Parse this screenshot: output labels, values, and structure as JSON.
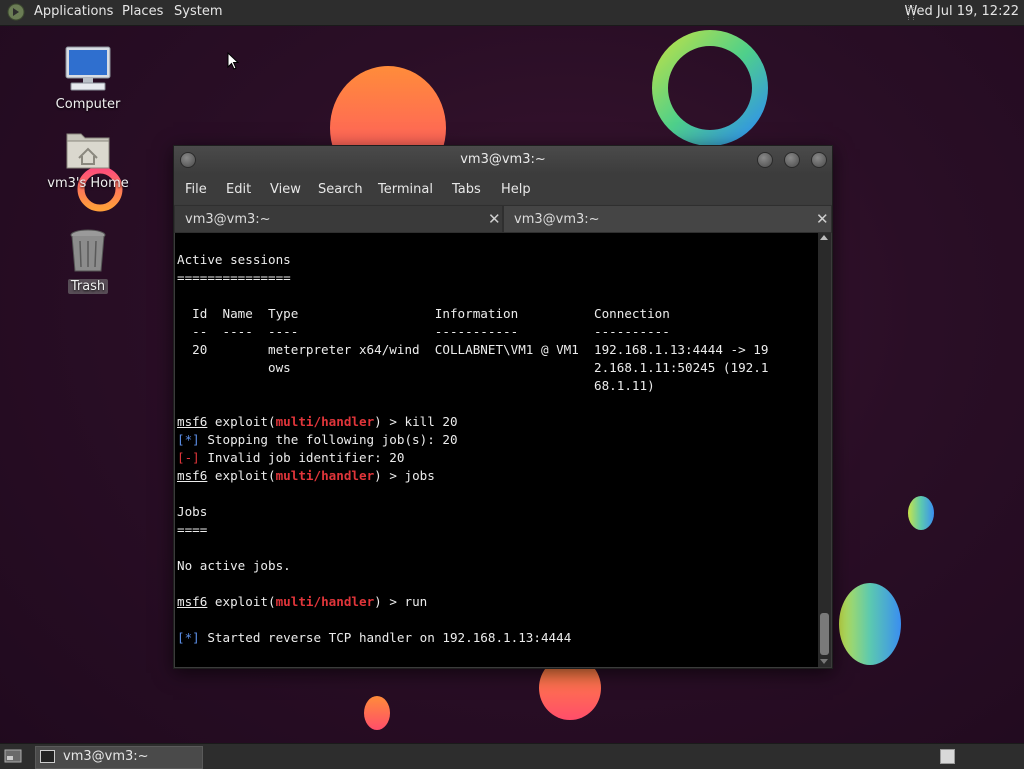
{
  "top_panel": {
    "menu": [
      "Applications",
      "Places",
      "System"
    ],
    "clock": "Wed Jul 19, 12:22"
  },
  "desktop": {
    "icons": [
      {
        "label": "Computer",
        "icon": "computer-icon"
      },
      {
        "label": "vm3's Home",
        "icon": "home-folder-icon"
      },
      {
        "label": "Trash",
        "icon": "trash-icon"
      }
    ]
  },
  "terminal": {
    "title": "vm3@vm3:~",
    "menu": [
      "File",
      "Edit",
      "View",
      "Search",
      "Terminal",
      "Tabs",
      "Help"
    ],
    "tabs": [
      {
        "label": "vm3@vm3:~",
        "close": "✕"
      },
      {
        "label": "vm3@vm3:~",
        "close": "✕"
      }
    ],
    "prompt": {
      "prefix": "msf6",
      "middle": " exploit(",
      "module": "multi/handler",
      "suffix": ") > "
    },
    "lines": {
      "l1": "Active sessions",
      "l2": "===============",
      "l3": "  Id  Name  Type                  Information          Connection",
      "l4": "  --  ----  ----                  -----------          ----------",
      "l5": "  20        meterpreter x64/wind  COLLABNET\\VM1 @ VM1  192.168.1.13:4444 -> 19",
      "l6": "            ows                                        2.168.1.11:50245 (192.1",
      "l7": "                                                       68.1.11)",
      "cmd1": "kill 20",
      "info_tag": "[*]",
      "err_tag": "[-]",
      "l9": " Stopping the following job(s): 20",
      "l10": " Invalid job identifier: 20",
      "cmd2": "jobs",
      "l12": "Jobs",
      "l13": "====",
      "l14": "No active jobs.",
      "cmd3": "run",
      "l16": " Started reverse TCP handler on 192.168.1.13:4444"
    }
  },
  "taskbar": {
    "window_label": "vm3@vm3:~"
  },
  "colors": {
    "module_red": "#e0353a",
    "info_blue": "#5b8ee6",
    "desktop_bg": "#2a0e26"
  }
}
